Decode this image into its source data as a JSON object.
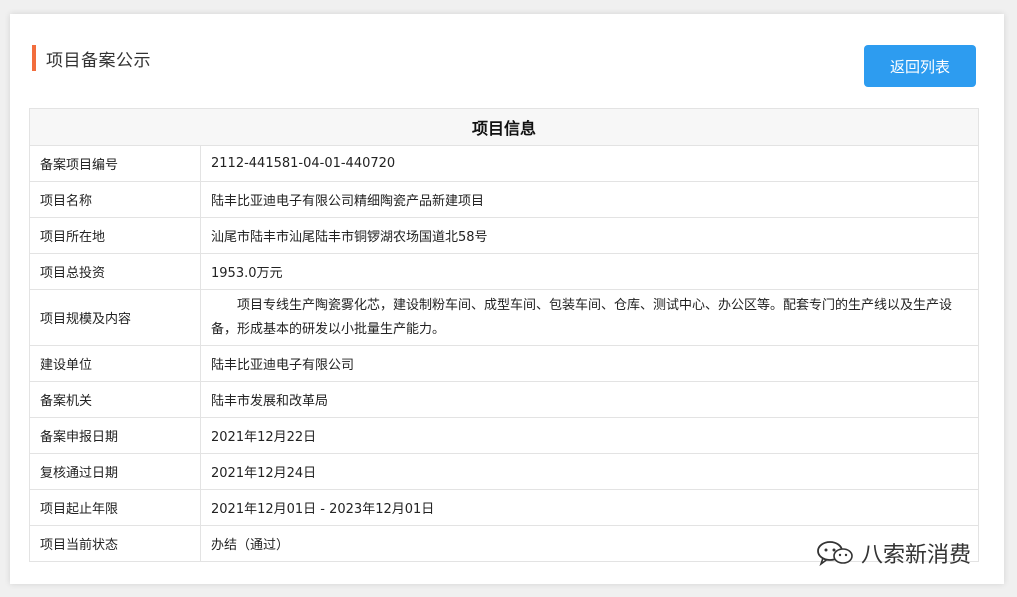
{
  "header": {
    "title": "项目备案公示",
    "back_button_label": "返回列表"
  },
  "table": {
    "heading": "项目信息",
    "rows": [
      {
        "label": "备案项目编号",
        "value": "2112-441581-04-01-440720"
      },
      {
        "label": "项目名称",
        "value": "陆丰比亚迪电子有限公司精细陶瓷产品新建项目"
      },
      {
        "label": "项目所在地",
        "value": "汕尾市陆丰市汕尾陆丰市铜锣湖农场国道北58号"
      },
      {
        "label": "项目总投资",
        "value": "1953.0万元"
      },
      {
        "label": "项目规模及内容",
        "value": "项目专线生产陶瓷雾化芯，建设制粉车间、成型车间、包装车间、仓库、测试中心、办公区等。配套专门的生产线以及生产设备，形成基本的研发以小批量生产能力。"
      },
      {
        "label": "建设单位",
        "value": "陆丰比亚迪电子有限公司"
      },
      {
        "label": "备案机关",
        "value": "陆丰市发展和改革局"
      },
      {
        "label": "备案申报日期",
        "value": "2021年12月22日"
      },
      {
        "label": "复核通过日期",
        "value": "2021年12月24日"
      },
      {
        "label": "项目起止年限",
        "value": "2021年12月01日 - 2023年12月01日"
      },
      {
        "label": "项目当前状态",
        "value": "办结（通过）"
      }
    ]
  },
  "watermark": {
    "text": "八索新消费",
    "icon": "wechat-icon"
  },
  "colors": {
    "accent_bar": "#f26d3d",
    "button": "#2d9cf0"
  }
}
